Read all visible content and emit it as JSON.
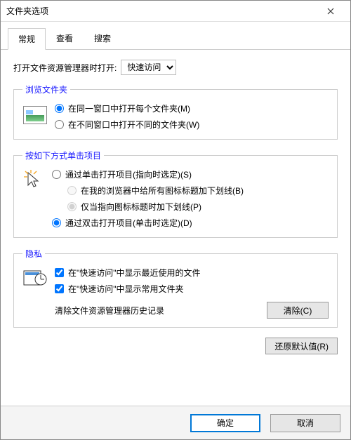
{
  "window": {
    "title": "文件夹选项"
  },
  "tabs": {
    "general": "常规",
    "view": "查看",
    "search": "搜索"
  },
  "dropdown": {
    "label": "打开文件资源管理器时打开:",
    "value": "快速访问"
  },
  "browse": {
    "legend": "浏览文件夹",
    "same": "在同一窗口中打开每个文件夹(M)",
    "diff": "在不同窗口中打开不同的文件夹(W)"
  },
  "click": {
    "legend": "按如下方式单击项目",
    "single": "通过单击打开项目(指向时选定)(S)",
    "sub1": "在我的浏览器中给所有图标标题加下划线(B)",
    "sub2": "仅当指向图标标题时加下划线(P)",
    "double": "通过双击打开项目(单击时选定)(D)"
  },
  "privacy": {
    "legend": "隐私",
    "recent": "在\"快速访问\"中显示最近使用的文件",
    "frequent": "在\"快速访问\"中显示常用文件夹",
    "clear_label": "清除文件资源管理器历史记录",
    "clear_btn": "清除(C)"
  },
  "restore": "还原默认值(R)",
  "footer": {
    "ok": "确定",
    "cancel": "取消"
  }
}
